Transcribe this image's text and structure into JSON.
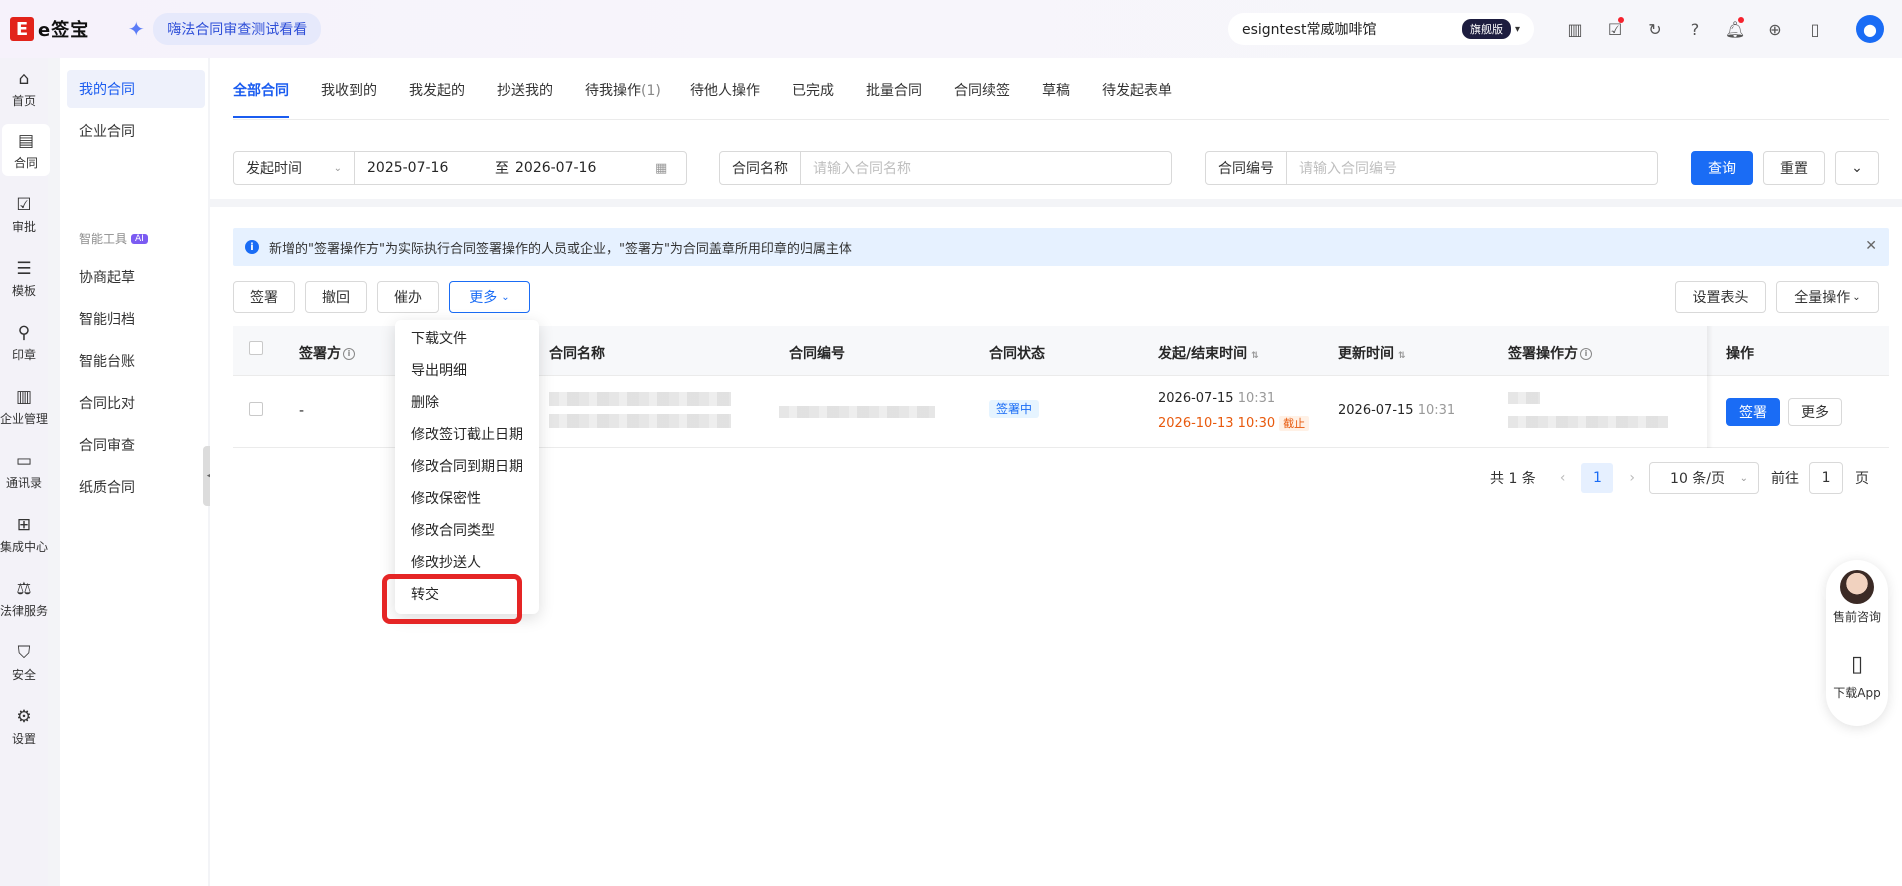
{
  "app": {
    "logo_mark": "E",
    "logo_text": "e签宝",
    "promo_text": "嗨法合同审查测试看看"
  },
  "account": {
    "name": "esigntest常威咖啡馆",
    "plan_badge": "旗舰版"
  },
  "top_icons": [
    "building-icon",
    "task-check-icon",
    "refresh-icon",
    "help-icon",
    "bell-icon",
    "globe-icon",
    "document-icon"
  ],
  "rail": [
    {
      "icon": "⌂",
      "label": "首页",
      "name": "home"
    },
    {
      "icon": "▤",
      "label": "合同",
      "name": "contract",
      "active": true
    },
    {
      "icon": "☑",
      "label": "审批",
      "name": "approval"
    },
    {
      "icon": "☰",
      "label": "模板",
      "name": "template"
    },
    {
      "icon": "⚲",
      "label": "印章",
      "name": "seal"
    },
    {
      "icon": "▥",
      "label": "企业管理",
      "name": "enterprise"
    },
    {
      "icon": "▭",
      "label": "通讯录",
      "name": "contacts"
    },
    {
      "icon": "⊞",
      "label": "集成中心",
      "name": "integration"
    },
    {
      "icon": "⚖",
      "label": "法律服务",
      "name": "legal"
    },
    {
      "icon": "⛉",
      "label": "安全",
      "name": "security"
    },
    {
      "icon": "⚙",
      "label": "设置",
      "name": "settings"
    }
  ],
  "subnav": {
    "items": [
      {
        "label": "我的合同",
        "active": true
      },
      {
        "label": "企业合同"
      }
    ],
    "group_label": "智能工具",
    "group_badge": "AI",
    "tools": [
      "协商起草",
      "智能归档",
      "智能台账",
      "合同比对",
      "合同审查",
      "纸质合同"
    ]
  },
  "tabs": [
    {
      "label": "全部合同",
      "active": true
    },
    {
      "label": "我收到的"
    },
    {
      "label": "我发起的"
    },
    {
      "label": "抄送我的"
    },
    {
      "label": "待我操作",
      "count": "(1)"
    },
    {
      "label": "待他人操作"
    },
    {
      "label": "已完成"
    },
    {
      "label": "批量合同"
    },
    {
      "label": "合同续签"
    },
    {
      "label": "草稿"
    },
    {
      "label": "待发起表单"
    }
  ],
  "filters": {
    "date_type": "发起时间",
    "date_start": "2025-07-16",
    "date_sep": "至",
    "date_end": "2026-07-16",
    "name_label": "合同名称",
    "name_placeholder": "请输入合同名称",
    "no_label": "合同编号",
    "no_placeholder": "请输入合同编号",
    "query": "查询",
    "reset": "重置"
  },
  "notice": {
    "text": "新增的\"签署操作方\"为实际执行合同签署操作的人员或企业，\"签署方\"为合同盖章所用印章的归属主体"
  },
  "actions": {
    "sign": "签署",
    "revoke": "撤回",
    "urge": "催办",
    "more": "更多",
    "set_header": "设置表头",
    "bulk_ops": "全量操作"
  },
  "table": {
    "headers": {
      "signer": "签署方",
      "name": "合同名称",
      "no": "合同编号",
      "status": "合同状态",
      "start_end": "发起/结束时间",
      "updated": "更新时间",
      "operator": "签署操作方",
      "ops": "操作"
    },
    "rows": [
      {
        "signer": "-",
        "status": "签署中",
        "start_date": "2026-07-15",
        "start_time": "10:31",
        "end": "2026-10-13 10:30",
        "end_tag": "截止",
        "updated_date": "2026-07-15",
        "updated_time": "10:31",
        "op_sign": "签署",
        "op_more": "更多"
      }
    ]
  },
  "pagination": {
    "total": "共 1 条",
    "current": "1",
    "page_size": "10 条/页",
    "goto_label": "前往",
    "goto_value": "1",
    "page_suffix": "页"
  },
  "more_menu": [
    "下载文件",
    "导出明细",
    "删除",
    "修改签订截止日期",
    "修改合同到期日期",
    "修改保密性",
    "修改合同类型",
    "修改抄送人",
    "转交"
  ],
  "float_widget": {
    "consult": "售前咨询",
    "download": "下载App"
  }
}
